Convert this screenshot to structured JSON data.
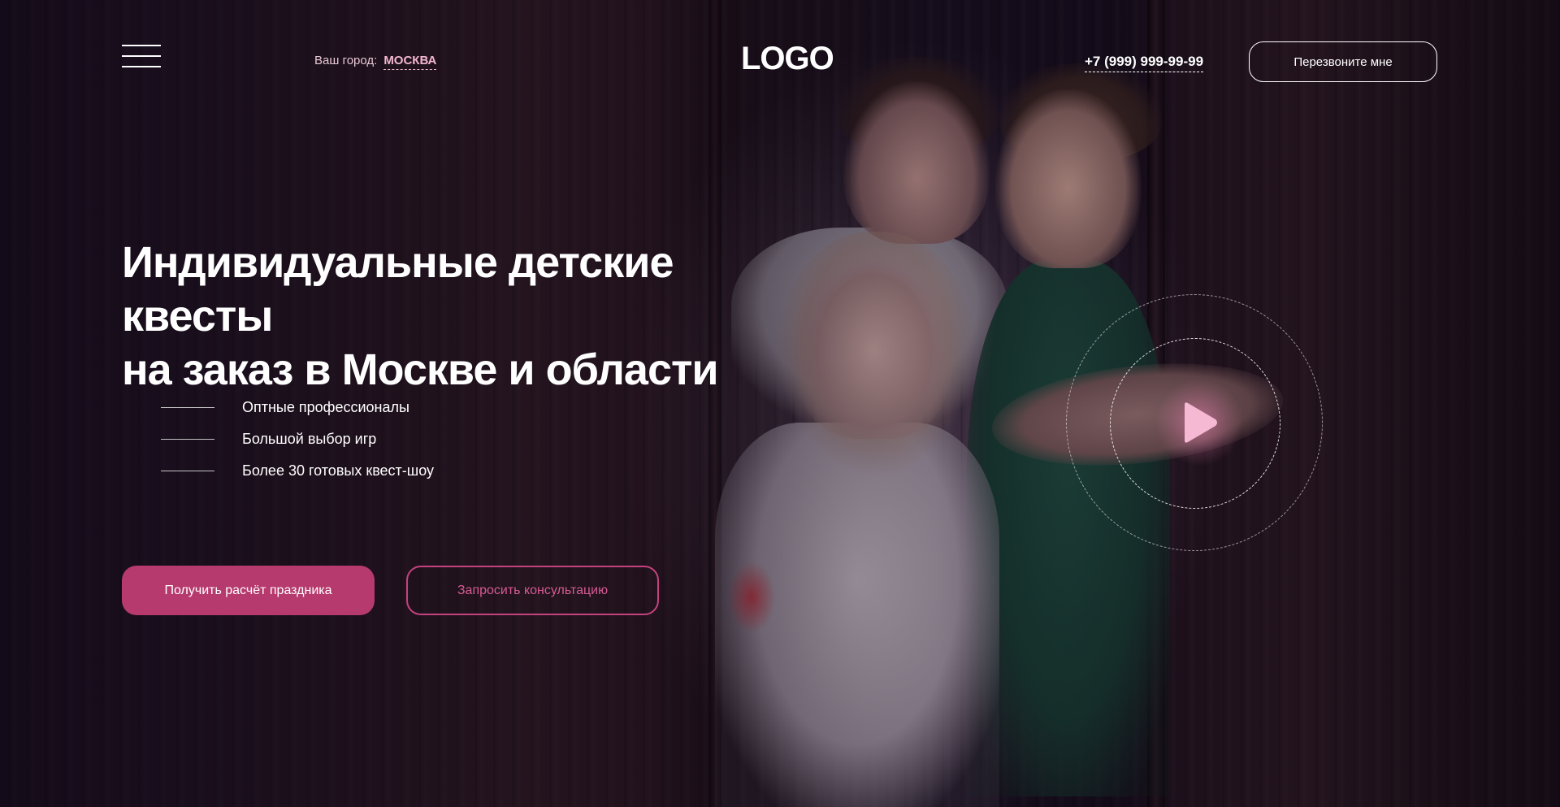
{
  "header": {
    "city_label": "Ваш город:",
    "city_value": "МОСКВА",
    "logo": "LOGO",
    "phone": "+7 (999) 999-99-99",
    "callback_label": "Перезвоните мне"
  },
  "hero": {
    "title_line1": "Индивидуальные детские квесты",
    "title_line2": "на заказ в Москве и области",
    "features": [
      "Оптные профессионалы",
      "Большой выбор игр",
      "Более 30 готовых квест-шоу"
    ],
    "primary_cta": "Получить расчёт праздника",
    "secondary_cta": "Запросить консультацию"
  },
  "icons": {
    "menu": "hamburger-menu-icon",
    "play": "play-icon"
  },
  "colors": {
    "accent": "#b63a6e",
    "accent_outline": "#c4437e",
    "accent_light": "#f3b7cf",
    "background": "#120b1a",
    "play": "#f6b9d3"
  }
}
